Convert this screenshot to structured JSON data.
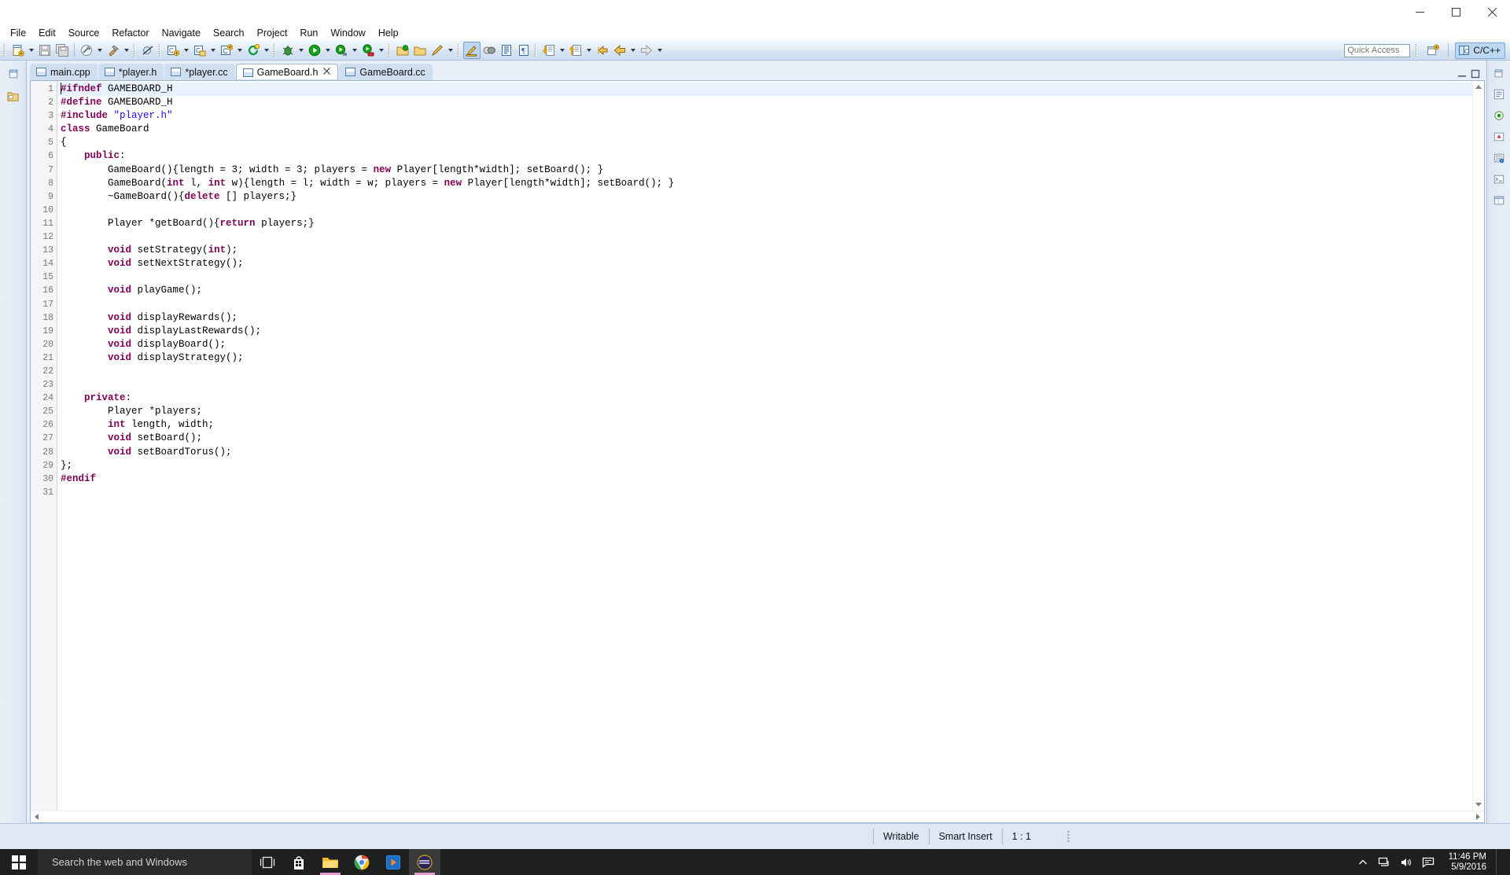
{
  "window": {
    "buttons": {
      "minimize": "minimize",
      "maximize": "maximize",
      "close": "close"
    }
  },
  "menubar": {
    "items": [
      "File",
      "Edit",
      "Source",
      "Refactor",
      "Navigate",
      "Search",
      "Project",
      "Run",
      "Window",
      "Help"
    ]
  },
  "toolbar": {
    "quick_access_placeholder": "Quick Access",
    "perspective_label": "C/C++",
    "icons": [
      "new-file-icon",
      "save-icon",
      "save-all-icon",
      "build-all-icon",
      "build-hammer-icon",
      "skip-breakpoints-icon",
      "new-c-class-icon",
      "new-c-file-icon",
      "new-c-project-icon",
      "refresh-icon",
      "debug-icon",
      "run-icon",
      "run-history-icon",
      "run-last-icon",
      "open-project-icon",
      "close-project-icon",
      "edit-pencil-icon",
      "highlight-icon",
      "mask-icon",
      "show-block-icon",
      "pilcrow-icon",
      "next-annotation-icon",
      "previous-annotation-icon",
      "back-icon",
      "forward-icon"
    ]
  },
  "editor": {
    "tabs": [
      {
        "label": "main.cpp",
        "dirty": false,
        "active": false
      },
      {
        "label": "*player.h",
        "dirty": true,
        "active": false
      },
      {
        "label": "*player.cc",
        "dirty": true,
        "active": false
      },
      {
        "label": "GameBoard.h",
        "dirty": false,
        "active": true
      },
      {
        "label": "GameBoard.cc",
        "dirty": false,
        "active": false
      }
    ],
    "first_line": 1,
    "lines": [
      {
        "n": 1,
        "tokens": [
          {
            "t": "pp",
            "v": "#ifndef"
          },
          {
            "t": "p",
            "v": " GAMEBOARD_H"
          }
        ]
      },
      {
        "n": 2,
        "tokens": [
          {
            "t": "pp",
            "v": "#define"
          },
          {
            "t": "p",
            "v": " GAMEBOARD_H"
          }
        ]
      },
      {
        "n": 3,
        "tokens": [
          {
            "t": "pp",
            "v": "#include"
          },
          {
            "t": "p",
            "v": " "
          },
          {
            "t": "str",
            "v": "\"player.h\""
          }
        ]
      },
      {
        "n": 4,
        "tokens": [
          {
            "t": "kw",
            "v": "class"
          },
          {
            "t": "p",
            "v": " GameBoard"
          }
        ]
      },
      {
        "n": 5,
        "tokens": [
          {
            "t": "p",
            "v": "{"
          }
        ]
      },
      {
        "n": 6,
        "tokens": [
          {
            "t": "p",
            "v": "    "
          },
          {
            "t": "kw",
            "v": "public"
          },
          {
            "t": "p",
            "v": ":"
          }
        ]
      },
      {
        "n": 7,
        "tokens": [
          {
            "t": "p",
            "v": "        GameBoard(){length = 3; width = 3; players = "
          },
          {
            "t": "kw",
            "v": "new"
          },
          {
            "t": "p",
            "v": " Player[length*width]; setBoard(); }"
          }
        ]
      },
      {
        "n": 8,
        "tokens": [
          {
            "t": "p",
            "v": "        GameBoard("
          },
          {
            "t": "kw",
            "v": "int"
          },
          {
            "t": "p",
            "v": " l, "
          },
          {
            "t": "kw",
            "v": "int"
          },
          {
            "t": "p",
            "v": " w){length = l; width = w; players = "
          },
          {
            "t": "kw",
            "v": "new"
          },
          {
            "t": "p",
            "v": " Player[length*width]; setBoard(); }"
          }
        ]
      },
      {
        "n": 9,
        "tokens": [
          {
            "t": "p",
            "v": "        ~GameBoard(){"
          },
          {
            "t": "kw",
            "v": "delete"
          },
          {
            "t": "p",
            "v": " [] players;}"
          }
        ]
      },
      {
        "n": 10,
        "tokens": [
          {
            "t": "p",
            "v": ""
          }
        ]
      },
      {
        "n": 11,
        "tokens": [
          {
            "t": "p",
            "v": "        Player *getBoard(){"
          },
          {
            "t": "kw",
            "v": "return"
          },
          {
            "t": "p",
            "v": " players;}"
          }
        ]
      },
      {
        "n": 12,
        "tokens": [
          {
            "t": "p",
            "v": ""
          }
        ]
      },
      {
        "n": 13,
        "tokens": [
          {
            "t": "p",
            "v": "        "
          },
          {
            "t": "kw",
            "v": "void"
          },
          {
            "t": "p",
            "v": " setStrategy("
          },
          {
            "t": "kw",
            "v": "int"
          },
          {
            "t": "p",
            "v": ");"
          }
        ]
      },
      {
        "n": 14,
        "tokens": [
          {
            "t": "p",
            "v": "        "
          },
          {
            "t": "kw",
            "v": "void"
          },
          {
            "t": "p",
            "v": " setNextStrategy();"
          }
        ]
      },
      {
        "n": 15,
        "tokens": [
          {
            "t": "p",
            "v": ""
          }
        ]
      },
      {
        "n": 16,
        "tokens": [
          {
            "t": "p",
            "v": "        "
          },
          {
            "t": "kw",
            "v": "void"
          },
          {
            "t": "p",
            "v": " playGame();"
          }
        ]
      },
      {
        "n": 17,
        "tokens": [
          {
            "t": "p",
            "v": ""
          }
        ]
      },
      {
        "n": 18,
        "tokens": [
          {
            "t": "p",
            "v": "        "
          },
          {
            "t": "kw",
            "v": "void"
          },
          {
            "t": "p",
            "v": " displayRewards();"
          }
        ]
      },
      {
        "n": 19,
        "tokens": [
          {
            "t": "p",
            "v": "        "
          },
          {
            "t": "kw",
            "v": "void"
          },
          {
            "t": "p",
            "v": " displayLastRewards();"
          }
        ]
      },
      {
        "n": 20,
        "tokens": [
          {
            "t": "p",
            "v": "        "
          },
          {
            "t": "kw",
            "v": "void"
          },
          {
            "t": "p",
            "v": " displayBoard();"
          }
        ]
      },
      {
        "n": 21,
        "tokens": [
          {
            "t": "p",
            "v": "        "
          },
          {
            "t": "kw",
            "v": "void"
          },
          {
            "t": "p",
            "v": " displayStrategy();"
          }
        ]
      },
      {
        "n": 22,
        "tokens": [
          {
            "t": "p",
            "v": ""
          }
        ]
      },
      {
        "n": 23,
        "tokens": [
          {
            "t": "p",
            "v": ""
          }
        ]
      },
      {
        "n": 24,
        "tokens": [
          {
            "t": "p",
            "v": "    "
          },
          {
            "t": "kw",
            "v": "private"
          },
          {
            "t": "p",
            "v": ":"
          }
        ]
      },
      {
        "n": 25,
        "tokens": [
          {
            "t": "p",
            "v": "        Player *players;"
          }
        ]
      },
      {
        "n": 26,
        "tokens": [
          {
            "t": "p",
            "v": "        "
          },
          {
            "t": "kw",
            "v": "int"
          },
          {
            "t": "p",
            "v": " length, width;"
          }
        ]
      },
      {
        "n": 27,
        "tokens": [
          {
            "t": "p",
            "v": "        "
          },
          {
            "t": "kw",
            "v": "void"
          },
          {
            "t": "p",
            "v": " setBoard();"
          }
        ]
      },
      {
        "n": 28,
        "tokens": [
          {
            "t": "p",
            "v": "        "
          },
          {
            "t": "kw",
            "v": "void"
          },
          {
            "t": "p",
            "v": " setBoardTorus();"
          }
        ]
      },
      {
        "n": 29,
        "tokens": [
          {
            "t": "p",
            "v": "};"
          }
        ]
      },
      {
        "n": 30,
        "tokens": [
          {
            "t": "pp",
            "v": "#endif"
          }
        ]
      },
      {
        "n": 31,
        "tokens": [
          {
            "t": "p",
            "v": ""
          }
        ]
      }
    ]
  },
  "statusbar": {
    "writable": "Writable",
    "insert_mode": "Smart Insert",
    "position": "1 : 1"
  },
  "taskbar": {
    "search_placeholder": "Search the web and Windows",
    "items": [
      {
        "name": "task-view-icon"
      },
      {
        "name": "store-icon"
      },
      {
        "name": "file-explorer-icon"
      },
      {
        "name": "chrome-icon"
      },
      {
        "name": "media-player-icon"
      },
      {
        "name": "eclipse-icon"
      }
    ],
    "clock_time": "11:46 PM",
    "clock_date": "5/9/2016"
  },
  "colors": {
    "keyword": "#7f0055",
    "string": "#2a00ff",
    "tab_active_bg": "#ffffff",
    "tab_inactive_bg": "#cfdff0",
    "toolbar_bg": "#dbe6f4",
    "status_bg": "#dfe7f5",
    "taskbar_bg": "#1f1f1f"
  }
}
